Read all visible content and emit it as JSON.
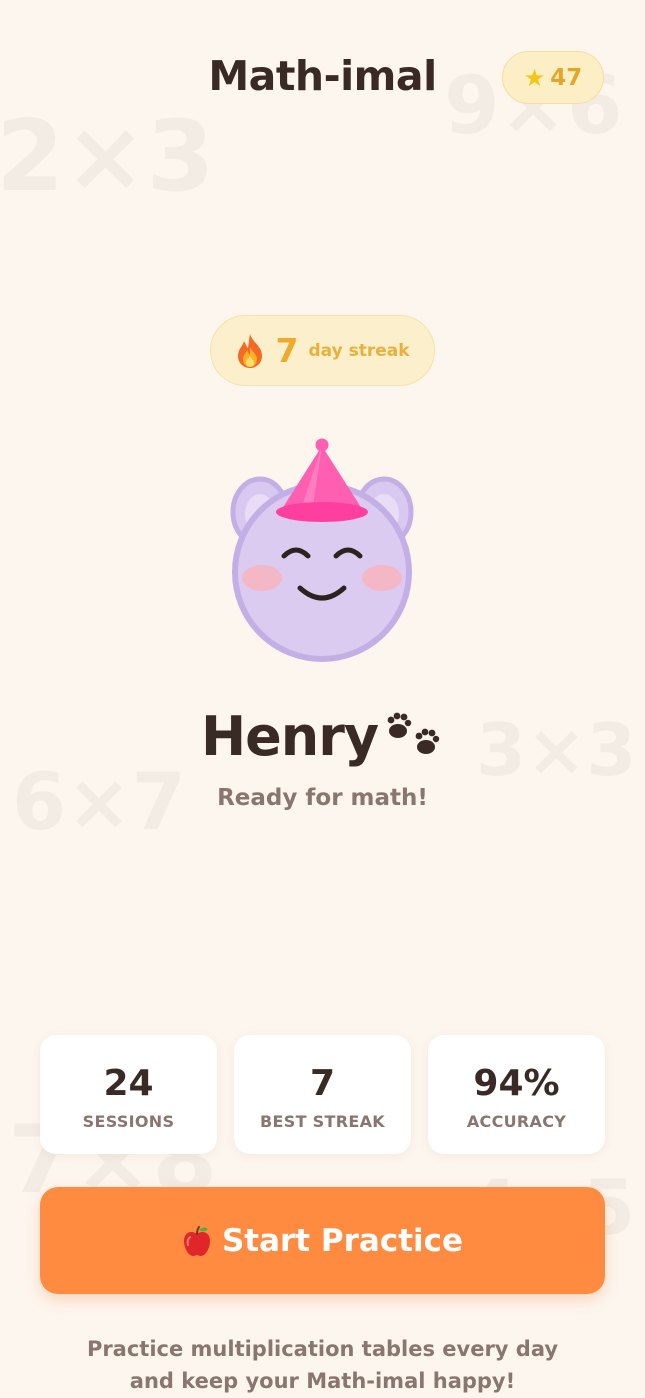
{
  "app": {
    "title": "Math-imal",
    "stars": "47",
    "star_icon": "star-icon"
  },
  "background_facts": [
    "2×3",
    "9×6",
    "6×7",
    "3×3",
    "7×8",
    "4×5"
  ],
  "streak": {
    "icon": "flame-icon",
    "count": "7",
    "label": "day streak"
  },
  "pet": {
    "name": "Henry",
    "name_icon": "paw-prints-icon",
    "status": "Ready for math!",
    "colors": {
      "body": "#d9c8ef",
      "outline": "#c3aee6",
      "hat": "#ff5fb0",
      "cheeks": "#f7b4be"
    }
  },
  "stats": [
    {
      "value": "24",
      "label": "SESSIONS"
    },
    {
      "value": "7",
      "label": "BEST STREAK"
    },
    {
      "value": "94%",
      "label": "ACCURACY"
    }
  ],
  "cta": {
    "icon": "apple-icon",
    "label": "Start Practice"
  },
  "footer": {
    "line1": "Practice multiplication tables every day",
    "line2": "and keep your Math-imal happy!"
  },
  "colors": {
    "background": "#fdf6ee",
    "accent_orange": "#fe8b40",
    "streak_gold": "#eeaa2a",
    "text_dark": "#3a2a26",
    "text_muted": "#8a7670"
  }
}
